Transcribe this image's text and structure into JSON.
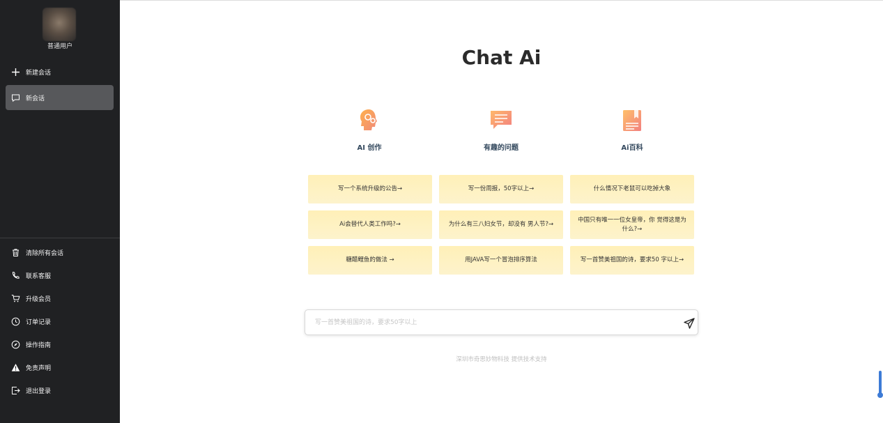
{
  "sidebar": {
    "username": "普通用户",
    "new_chat": "新建会话",
    "session": "新会话",
    "clear_all": "清除所有会话",
    "contact": "联系客服",
    "upgrade": "升级会员",
    "orders": "订单记录",
    "guide": "操作指南",
    "disclaimer": "免责声明",
    "logout": "退出登录"
  },
  "main": {
    "title": "Chat Ai",
    "categories": [
      {
        "label": "AI 创作",
        "icon": "ai-head-icon"
      },
      {
        "label": "有趣的问题",
        "icon": "chat-bubble-icon"
      },
      {
        "label": "Ai百科",
        "icon": "book-icon"
      }
    ],
    "cards": [
      "写一个系统升级的公告→",
      "写一份周报，50字以上→",
      "什么情况下老鼠可以吃掉大象",
      "Ai会替代人类工作吗?→",
      "为什么有三八妇女节，却没有 男人节?→",
      "中国只有唯一一位女皇帝，你 觉得这是为什么?→",
      "糖醋鲤鱼的做法 →",
      "用JAVA写一个冒泡排序算法",
      "写一首赞美祖国的诗，要求50 字以上→"
    ],
    "input_placeholder": "写一首赞美祖国的诗，要求50字以上",
    "footer": "深圳市奇思妙物科技 提供技术支持"
  },
  "colors": {
    "sidebar_bg": "#202123",
    "card_bg": "#fff0b8",
    "accent": "#f6a26b"
  }
}
